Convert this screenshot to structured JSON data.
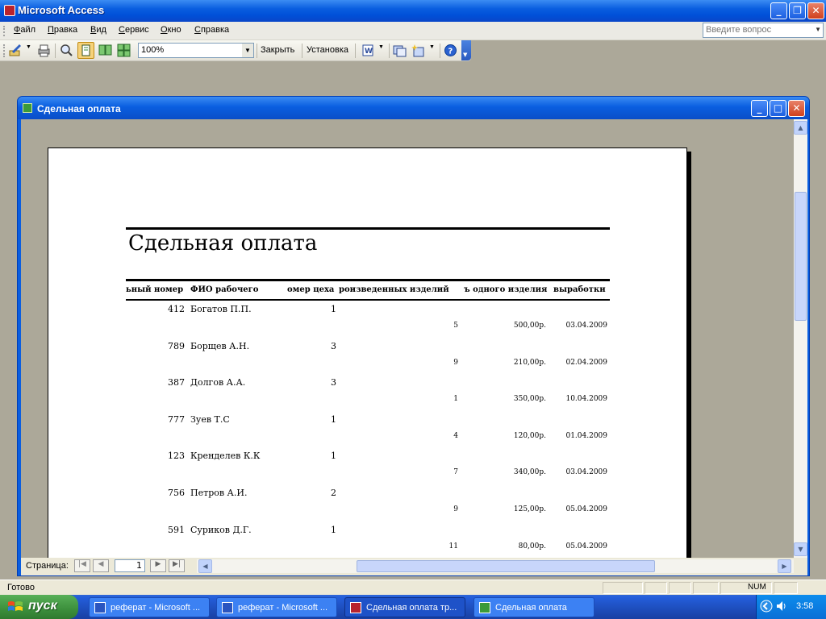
{
  "app": {
    "title": "Microsoft Access"
  },
  "menu": {
    "items": [
      "Файл",
      "Правка",
      "Вид",
      "Сервис",
      "Окно",
      "Справка"
    ],
    "ask_placeholder": "Введите вопрос"
  },
  "toolbar": {
    "zoom": "100%",
    "close_label": "Закрыть",
    "setup_label": "Установка"
  },
  "window": {
    "title": "Сдельная оплата"
  },
  "report": {
    "title": "Сдельная оплата",
    "headers": [
      "ьный номер",
      "ФИО рабочего",
      "омер цеха",
      "роизведенных изделий",
      "ъ одного изделия",
      "выработки"
    ],
    "rows": [
      {
        "num": "412",
        "fio": "Богатов П.П.",
        "shop": "1",
        "qty": "5",
        "price": "500,00р.",
        "date": "03.04.2009"
      },
      {
        "num": "789",
        "fio": "Борщев А.Н.",
        "shop": "3",
        "qty": "9",
        "price": "210,00р.",
        "date": "02.04.2009"
      },
      {
        "num": "387",
        "fio": "Долгов А.А.",
        "shop": "3",
        "qty": "1",
        "price": "350,00р.",
        "date": "10.04.2009"
      },
      {
        "num": "777",
        "fio": "Зуев Т.С",
        "shop": "1",
        "qty": "4",
        "price": "120,00р.",
        "date": "01.04.2009"
      },
      {
        "num": "123",
        "fio": "Кренделев  К.К",
        "shop": "1",
        "qty": "7",
        "price": "340,00р.",
        "date": "03.04.2009"
      },
      {
        "num": "756",
        "fio": "Петров А.И.",
        "shop": "2",
        "qty": "9",
        "price": "125,00р.",
        "date": "05.04.2009"
      },
      {
        "num": "591",
        "fio": "Суриков Д.Г.",
        "shop": "1",
        "qty": "11",
        "price": "80,00р.",
        "date": "05.04.2009"
      }
    ]
  },
  "pager": {
    "label": "Страница:",
    "page": "1"
  },
  "status": {
    "text": "Готово",
    "num": "NUM"
  },
  "taskbar": {
    "start": "пуск",
    "tasks": [
      "реферат - Microsoft ...",
      "реферат - Microsoft ...",
      "Сдельная оплата тр...",
      "Сдельная оплата"
    ],
    "clock": "3:58"
  }
}
